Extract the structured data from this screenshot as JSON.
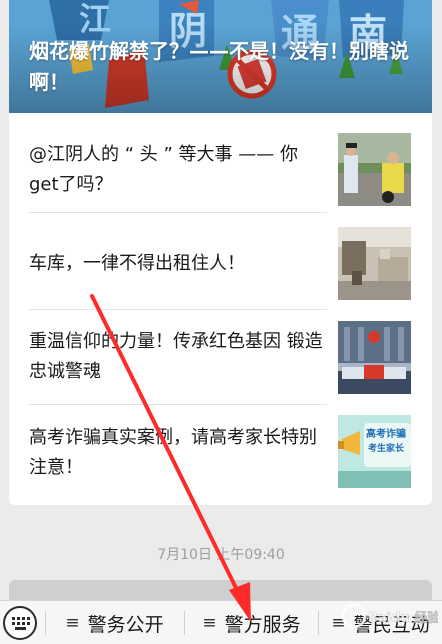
{
  "hero": {
    "title": "烟花爆竹解禁了？——不是！没有！别瞎说啊！",
    "art_words": [
      "江",
      "阴",
      "通",
      "南"
    ]
  },
  "articles": [
    {
      "title": "@江阴人的 “ 头 ” 等大事 —— 你get了吗？",
      "thumbnail": "police-roadside-photo"
    },
    {
      "title": "车库，一律不得出租住人！",
      "thumbnail": "garage-room-photo"
    },
    {
      "title": "重温信仰的力量！传承红色基因 锻造忠诚警魂",
      "thumbnail": "police-group-photo"
    },
    {
      "title": "高考诈骗真实案例，请高考家长特别注意！",
      "thumbnail": "exam-fraud-poster"
    }
  ],
  "thumb_texts": {
    "exam_line1": "高考诈骗",
    "exam_line2": "考生家长"
  },
  "timestamp": "7月10日 上午09:40",
  "menu": {
    "items": [
      {
        "label": "警务公开"
      },
      {
        "label": "警方服务"
      },
      {
        "label": "警民互动"
      }
    ]
  },
  "watermark": {
    "text": "Baidu 经验"
  },
  "colors": {
    "arrow": "#ff2b2b",
    "card": "#ffffff",
    "background": "#ebebeb",
    "timestamp": "#9e9e9e"
  }
}
